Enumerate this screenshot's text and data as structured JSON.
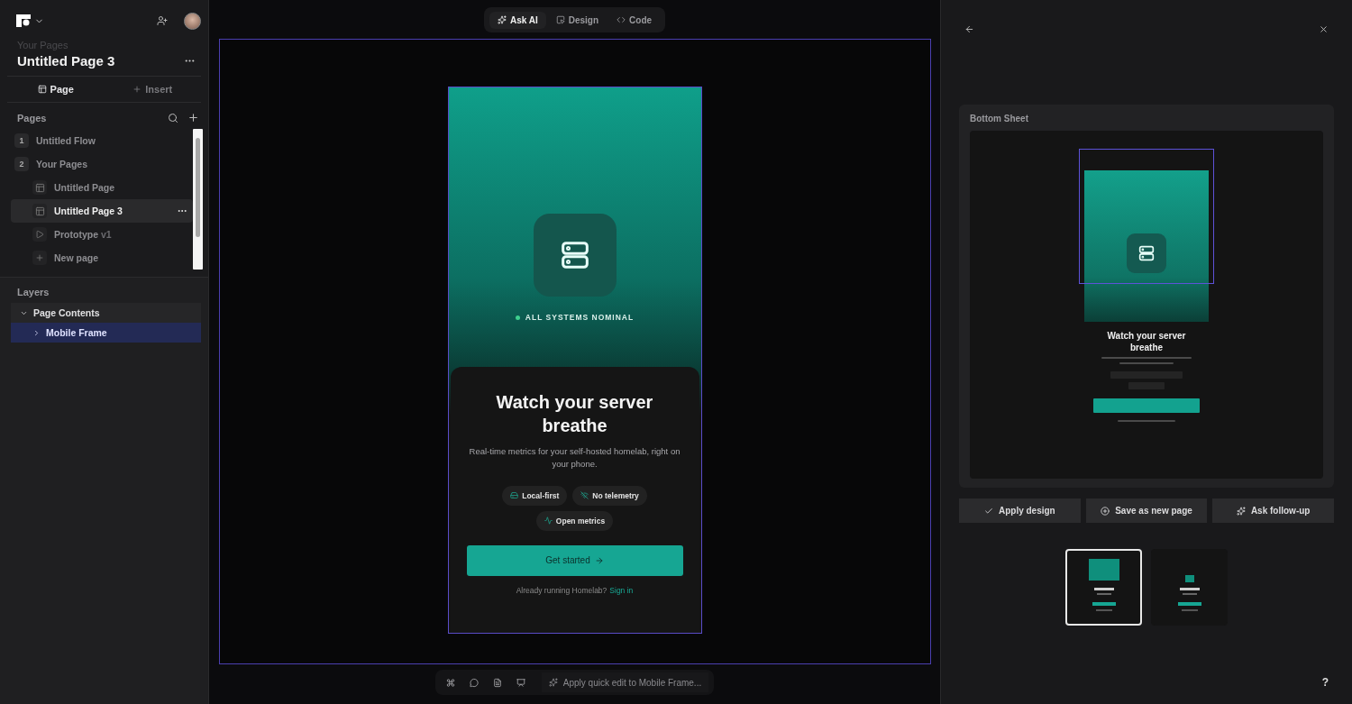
{
  "sidebar": {
    "breadcrumb": "Your Pages",
    "title": "Untitled Page 3",
    "tabs": [
      {
        "label": "Page",
        "selected": true
      },
      {
        "label": "Insert",
        "selected": false
      }
    ],
    "pages_header": "Pages",
    "pages": [
      {
        "number": "1",
        "label": "Untitled Flow",
        "selected": false
      },
      {
        "number": "2",
        "label": "Your Pages",
        "selected": false,
        "children": [
          {
            "kind": "page",
            "label": "Untitled Page",
            "selected": false
          },
          {
            "kind": "page",
            "label": "Untitled Page 3",
            "selected": true
          },
          {
            "kind": "prototype",
            "label": "Prototype",
            "badge": "v1",
            "selected": false
          },
          {
            "kind": "new",
            "label": "New page",
            "selected": false
          }
        ]
      }
    ],
    "layers_header": "Layers",
    "layers": [
      {
        "label": "Page Contents",
        "expanded": true,
        "selected": false,
        "children": [
          {
            "label": "Mobile Frame",
            "expanded": false,
            "selected": true
          }
        ]
      }
    ]
  },
  "mode_tabs": [
    {
      "label": "Ask AI",
      "selected": true
    },
    {
      "label": "Design",
      "selected": false
    },
    {
      "label": "Code",
      "selected": false
    }
  ],
  "mobile_frame": {
    "status": "ALL SYSTEMS NOMINAL",
    "headline": "Watch your server breathe",
    "description": "Real-time metrics for your self-hosted homelab, right on your phone.",
    "tags": [
      "Local-first",
      "No telemetry",
      "Open metrics"
    ],
    "cta": "Get started",
    "footer_text": "Already running Homelab?",
    "footer_link": "Sign in"
  },
  "bottom_toolbar": {
    "quick_edit": "Apply quick edit to Mobile Frame..."
  },
  "right_panel": {
    "preview_title": "Bottom Sheet",
    "preview_headline": "Watch your server breathe",
    "actions": [
      "Apply design",
      "Save as new page",
      "Ask follow-up"
    ],
    "thumbnails": [
      {
        "selected": true
      },
      {
        "selected": false
      }
    ]
  },
  "help": "?"
}
